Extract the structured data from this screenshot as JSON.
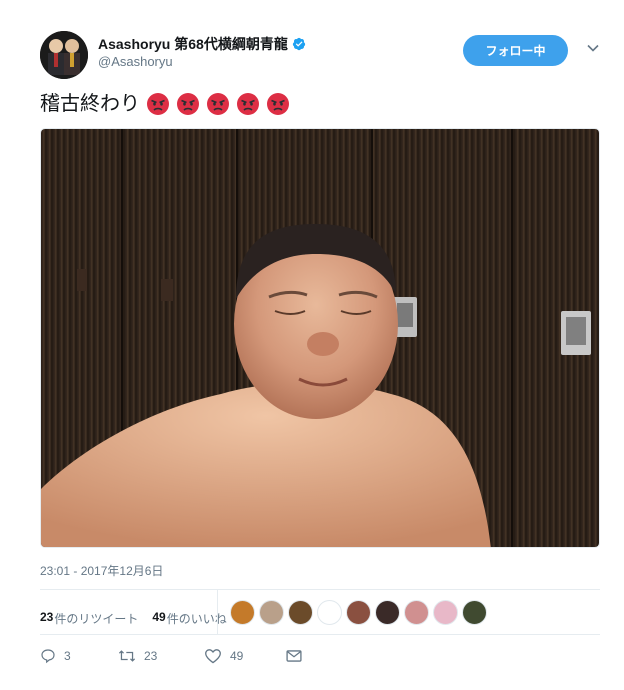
{
  "user": {
    "name": "Asashoryu 第68代横綱朝青龍",
    "handle": "@Asashoryu",
    "verified_icon": "verified-badge-icon"
  },
  "follow_button": {
    "label": "フォロー中"
  },
  "menu": {
    "icon": "chevron-down-icon"
  },
  "tweet": {
    "text": "稽古終わり",
    "emoji": [
      "angry-face",
      "angry-face",
      "angry-face",
      "angry-face",
      "angry-face"
    ]
  },
  "photo": {
    "icon": "photo"
  },
  "timestamp": "23:01 - 2017年12月6日",
  "stats": {
    "retweets_count": "23",
    "retweets_label": "件のリツイート",
    "likes_count": "49",
    "likes_label": "件のいいね"
  },
  "likers": [
    "#c47a2a",
    "#b9a08a",
    "#6b4b2a",
    "#ffffff",
    "#8a5040",
    "#3a2a28",
    "#d09090",
    "#e8b8c8",
    "#404a30"
  ],
  "actions": {
    "reply_count": "3",
    "retweet_count": "23",
    "like_count": "49"
  },
  "colors": {
    "accent": "#1da1f2",
    "follow_bg": "#3ea1ec",
    "meta": "#657786"
  }
}
